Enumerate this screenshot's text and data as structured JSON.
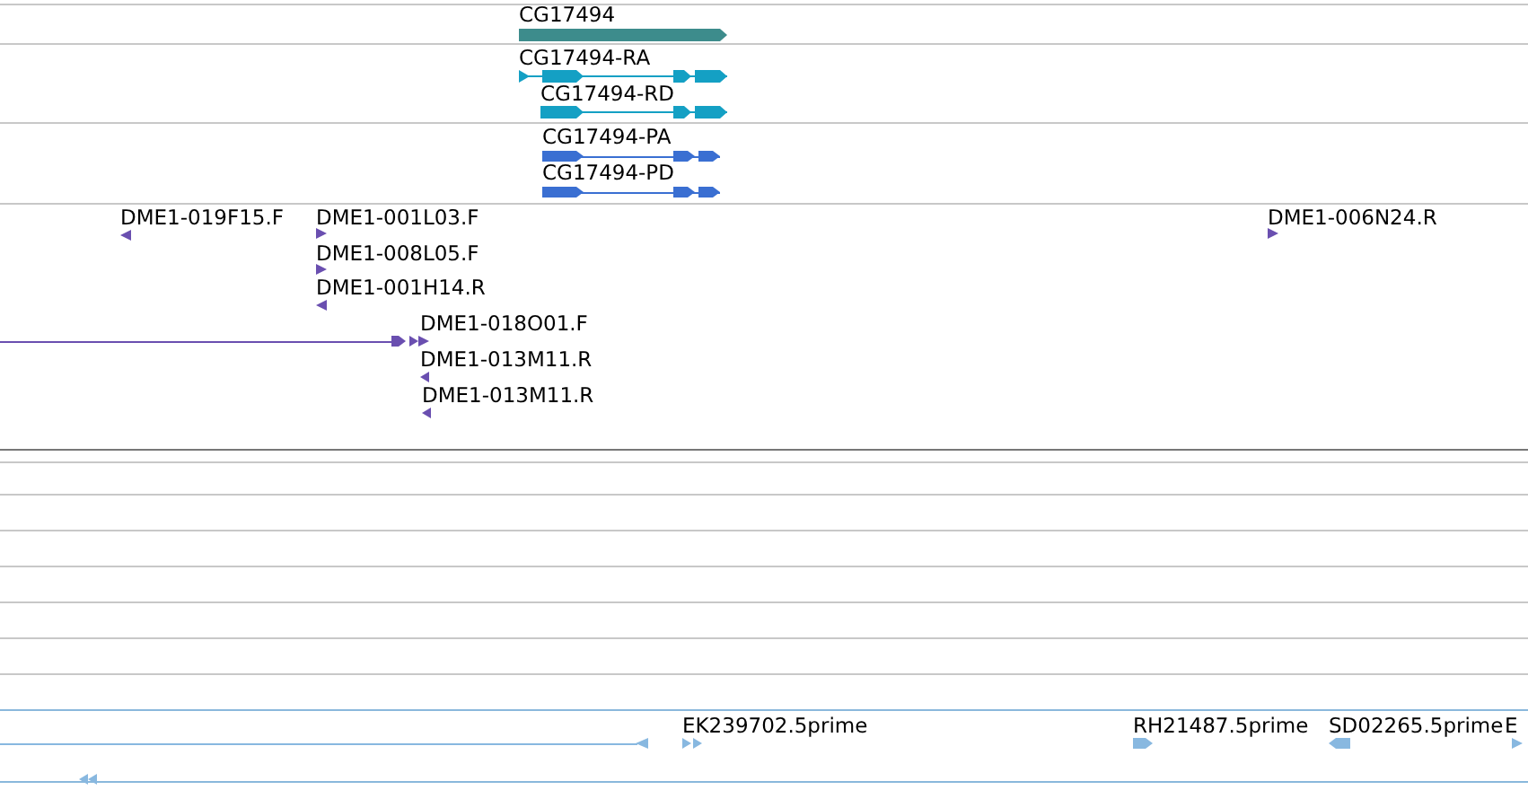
{
  "tracks": [
    {
      "kind": "gene",
      "features": [
        {
          "label": "CG17494",
          "reverse": false
        }
      ]
    },
    {
      "kind": "transcript",
      "features": [
        {
          "label": "CG17494-RA",
          "reverse": false
        },
        {
          "label": "CG17494-RD",
          "reverse": false
        }
      ]
    },
    {
      "kind": "protein",
      "features": [
        {
          "label": "CG17494-PA",
          "reverse": false
        },
        {
          "label": "CG17494-PD",
          "reverse": false
        }
      ]
    },
    {
      "kind": "clone",
      "features": [
        {
          "label": "DME1-019F15.F",
          "reverse": true
        },
        {
          "label": "DME1-001L03.F",
          "reverse": false
        },
        {
          "label": "DME1-008L05.F",
          "reverse": false
        },
        {
          "label": "DME1-001H14.R",
          "reverse": true
        },
        {
          "label": "DME1-018O01.F",
          "reverse": false
        },
        {
          "label": "DME1-013M11.R",
          "reverse": true
        },
        {
          "label": "DME1-013M11.R",
          "reverse": true
        },
        {
          "label": "DME1-006N24.R",
          "reverse": false
        }
      ]
    },
    {
      "kind": "est",
      "features": [
        {
          "reverse": true
        },
        {
          "label": "EK239702.5prime",
          "reverse": false
        },
        {
          "label": "RH21487.5prime",
          "reverse": false
        },
        {
          "label": "SD02265.5prime",
          "reverse": true
        },
        {
          "label": "E",
          "reverse": false
        },
        {
          "reverse": true
        }
      ]
    }
  ]
}
